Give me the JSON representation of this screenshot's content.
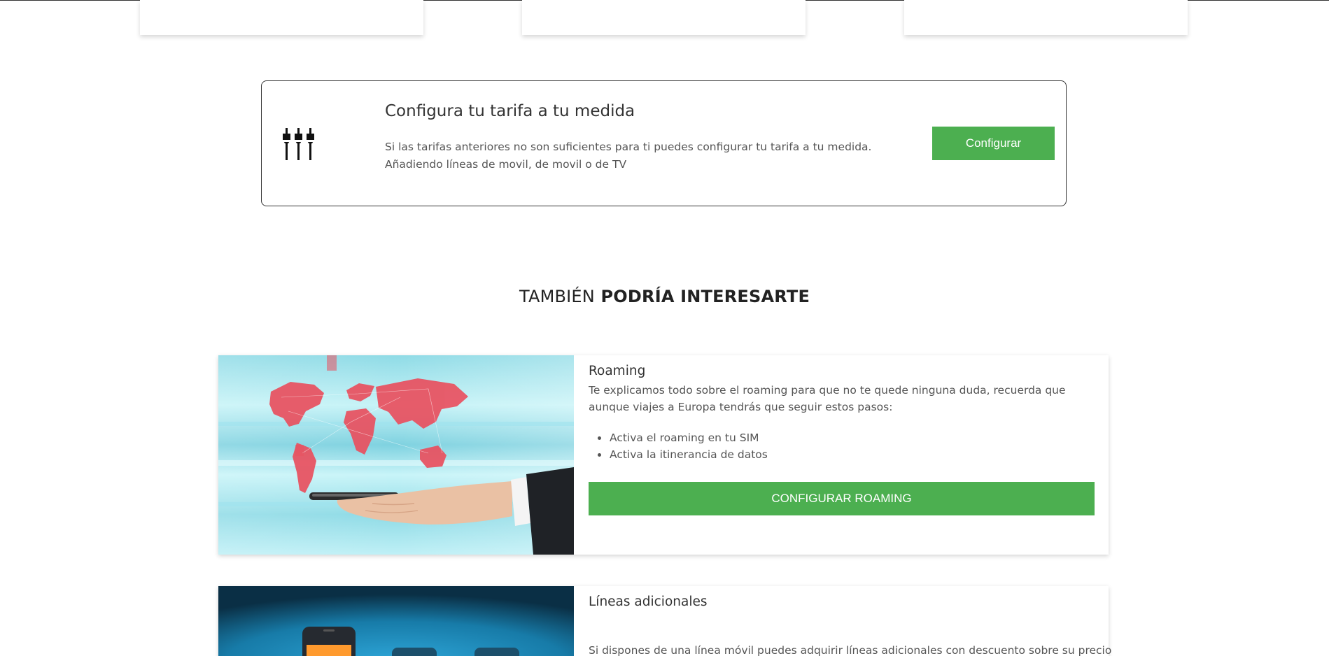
{
  "custom_tariff": {
    "icon": "plug-connectors-icon",
    "title": "Configura tu tarifa a tu medida",
    "description": "Si las tarifas anteriores no son suficientes para ti puedes configurar tu tarifa a tu medida. Añadiendo líneas de movil, de movil o de TV",
    "button_label": "Configurar"
  },
  "section": {
    "heading_light": "TAMBIÉN",
    "heading_bold": "PODRÍA INTERESARTE"
  },
  "offers": [
    {
      "title": "Roaming",
      "description": "Te explicamos todo sobre el roaming para que no te quede ninguna duda, recuerda que aunque viajes a Europa tendrás que seguir estos pasos:",
      "steps": [
        "Activa el roaming en tu SIM",
        "Activa la itinerancia de datos"
      ],
      "button_label": "CONFIGURAR ROAMING",
      "image": "world-map-on-smartphone-image"
    },
    {
      "title": "Líneas adicionales",
      "description": "Si dispones de una línea móvil puedes adquirir líneas adicionales con descuento sobre su precio",
      "image": "smartphones-blue-background-image"
    }
  ],
  "colors": {
    "accent_green": "#4caf50",
    "text_dark": "#333333",
    "text_muted": "#555555"
  }
}
